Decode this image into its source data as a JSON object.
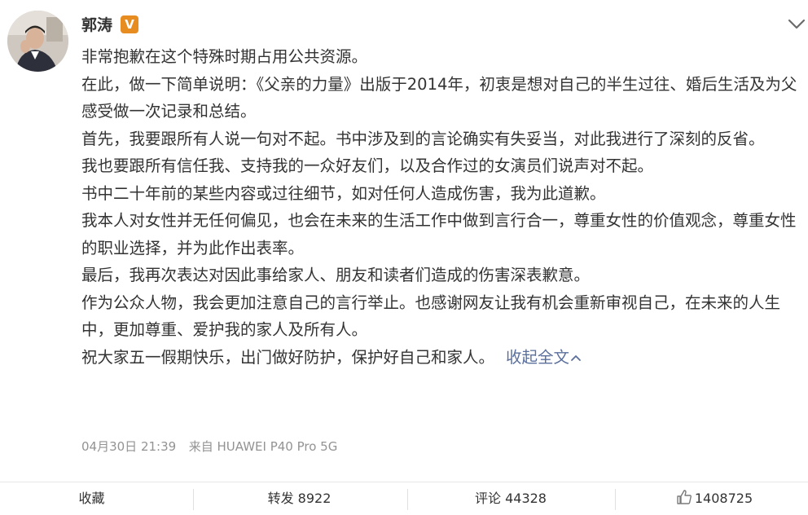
{
  "post": {
    "username": "郭涛",
    "verified_badge": "V",
    "icons": {
      "avatar": "profile-photo",
      "verified": "verified-badge-icon",
      "more": "chevron-down-icon",
      "collapse": "chevron-up-icon",
      "like": "thumbs-up-icon"
    },
    "paragraphs": [
      "非常抱歉在这个特殊时期占用公共资源。",
      "在此，做一下简单说明：《父亲的力量》出版于2014年，初衷是想对自己的半生过往、婚后生活及为父感受做一次记录和总结。",
      "首先，我要跟所有人说一句对不起。书中涉及到的言论确实有失妥当，对此我进行了深刻的反省。",
      "我也要跟所有信任我、支持我的一众好友们，以及合作过的女演员们说声对不起。",
      "书中二十年前的某些内容或过往细节，如对任何人造成伤害，我为此道歉。",
      "我本人对女性并无任何偏见，也会在未来的生活工作中做到言行合一，尊重女性的价值观念，尊重女性的职业选择，并为此作出表率。",
      "最后，我再次表达对因此事给家人、朋友和读者们造成的伤害深表歉意。",
      "作为公众人物，我会更加注意自己的言行举止。也感谢网友让我有机会重新审视自己，在未来的人生中，更加尊重、爱护我的家人及所有人。",
      "祝大家五一假期快乐，出门做好防护，保护好自己和家人。"
    ],
    "collapse_label": "收起全文",
    "timestamp": "04月30日 21:39",
    "source": "来自 HUAWEI P40 Pro 5G"
  },
  "actions": {
    "favorite": "收藏",
    "repost": "转发 8922",
    "comment": "评论 44328",
    "like": "1408725"
  },
  "colors": {
    "link": "#5a6f9c",
    "meta": "#939393",
    "badge": "#e68c20",
    "text": "#333333"
  }
}
